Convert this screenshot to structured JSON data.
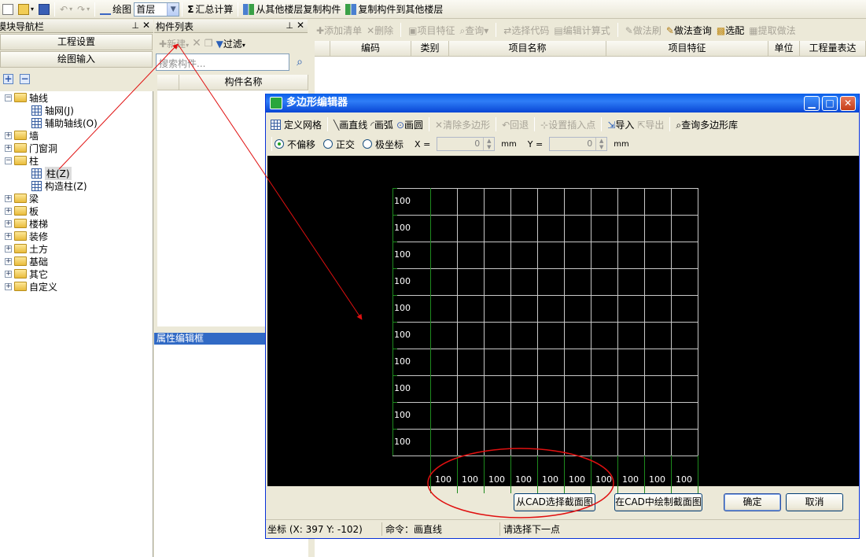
{
  "toolbar": {
    "draw_label": "绘图",
    "floor_value": "首层",
    "sum_label": "汇总计算",
    "copy_from_label": "从其他楼层复制构件",
    "copy_to_label": "复制构件到其他楼层"
  },
  "nav": {
    "title": "模块导航栏",
    "project_settings": "工程设置",
    "draw_input": "绘图输入",
    "tree": [
      {
        "label": "轴线",
        "expanded": true,
        "children": [
          {
            "label": "轴网(J)"
          },
          {
            "label": "辅助轴线(O)"
          }
        ]
      },
      {
        "label": "墙"
      },
      {
        "label": "门窗洞"
      },
      {
        "label": "柱",
        "expanded": true,
        "children": [
          {
            "label": "柱(Z)",
            "selected": true
          },
          {
            "label": "构造柱(Z)"
          }
        ]
      },
      {
        "label": "梁"
      },
      {
        "label": "板"
      },
      {
        "label": "楼梯"
      },
      {
        "label": "装修"
      },
      {
        "label": "土方"
      },
      {
        "label": "基础"
      },
      {
        "label": "其它"
      },
      {
        "label": "自定义"
      }
    ]
  },
  "component_list": {
    "title": "构件列表",
    "new_label": "新建",
    "filter_label": "过滤",
    "search_placeholder": "搜索构件...",
    "col_name": "构件名称",
    "prop_title": "属性编辑框"
  },
  "right_panel": {
    "add_list": "添加清单",
    "delete": "删除",
    "item_feature": "项目特征",
    "query": "查询",
    "select_code": "选择代码",
    "edit_formula": "编辑计算式",
    "method_brush": "做法刷",
    "method_query": "做法查询",
    "select_match": "选配",
    "extract_method": "提取做法",
    "columns": [
      "编码",
      "类别",
      "项目名称",
      "项目特征",
      "单位",
      "工程量表达"
    ]
  },
  "dialog": {
    "title": "多边形编辑器",
    "tools": {
      "define_grid": "定义网格",
      "line": "画直线",
      "arc": "画弧",
      "circle": "画圆",
      "clear_polygon": "清除多边形",
      "undo": "回退",
      "set_insert_point": "设置插入点",
      "import": "导入",
      "export": "导出",
      "query_lib": "查询多边形库"
    },
    "coord": {
      "no_offset": "不偏移",
      "ortho": "正交",
      "polar": "极坐标",
      "x_label": "X =",
      "x_value": "0",
      "x_unit": "mm",
      "y_label": "Y =",
      "y_value": "0",
      "y_unit": "mm"
    },
    "grid": {
      "rows": [
        100,
        100,
        100,
        100,
        100,
        100,
        100,
        100,
        100,
        100
      ],
      "cols": [
        100,
        100,
        100,
        100,
        100,
        100,
        100,
        100,
        100,
        100
      ]
    },
    "buttons": {
      "from_cad": "从CAD选择截面图",
      "draw_in_cad": "在CAD中绘制截面图",
      "ok": "确定",
      "cancel": "取消"
    },
    "status": {
      "coord": "坐标 (X: 397 Y: -102)",
      "command": "命令：画直线",
      "prompt": "请选择下一点"
    }
  }
}
